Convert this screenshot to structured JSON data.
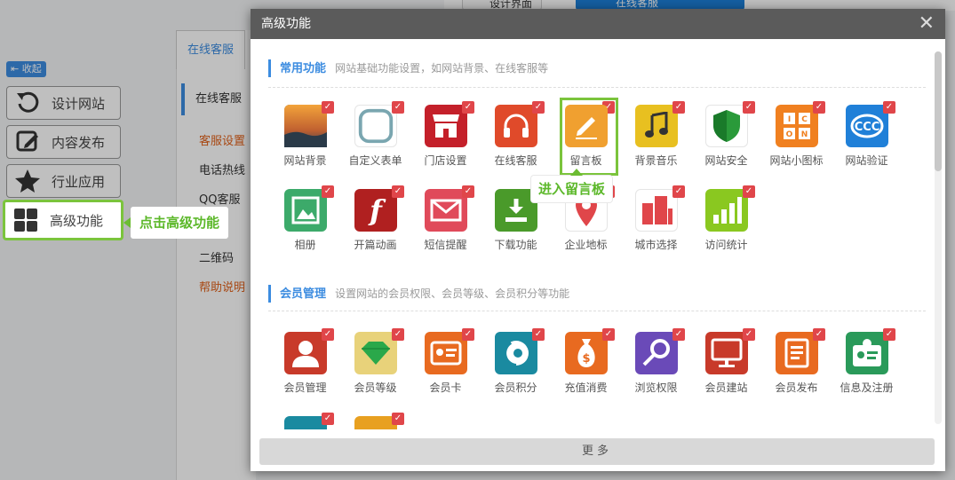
{
  "background": {
    "top_items": [
      "设计界面",
      "在线客服"
    ],
    "collapse_label": "收起",
    "nav": [
      {
        "label": "设计网站",
        "icon": "refresh-icon"
      },
      {
        "label": "内容发布",
        "icon": "edit-icon"
      },
      {
        "label": "行业应用",
        "icon": "star-icon"
      },
      {
        "label": "高级功能",
        "icon": "grid-icon"
      }
    ],
    "callout_left": "点击高级功能",
    "panel": {
      "tab": "在线客服",
      "head": "在线客服",
      "items": [
        "客服设置",
        "电话热线",
        "QQ客服",
        "二维码",
        "帮助说明"
      ]
    }
  },
  "modal": {
    "title": "高级功能",
    "close": "✕",
    "section1": {
      "name": "常用功能",
      "desc": "网站基础功能设置，如网站背景、在线客服等"
    },
    "section2": {
      "name": "会员管理",
      "desc": "设置网站的会员权限、会员等级、会员积分等功能"
    },
    "common": [
      {
        "label": "网站背景",
        "icon": "sunset-icon",
        "color": "#4a5a6a"
      },
      {
        "label": "自定义表单",
        "icon": "blank-form-icon",
        "color": "#ffffff"
      },
      {
        "label": "门店设置",
        "icon": "store-icon",
        "color": "#c4202a"
      },
      {
        "label": "在线客服",
        "icon": "headset-icon",
        "color": "#e04a2a"
      },
      {
        "label": "留言板",
        "icon": "pencil-icon",
        "color": "#f0a030"
      },
      {
        "label": "背景音乐",
        "icon": "music-note-icon",
        "color": "#e8c020"
      },
      {
        "label": "网站安全",
        "icon": "shield-icon",
        "color": "#ffffff"
      },
      {
        "label": "网站小图标",
        "icon": "icon-grid-icon",
        "color": "#f08020"
      },
      {
        "label": "网站验证",
        "icon": "verify-icon",
        "color": "#2080d8"
      },
      {
        "label": "相册",
        "icon": "album-icon",
        "color": "#3caa6a"
      },
      {
        "label": "开篇动画",
        "icon": "flash-icon",
        "color": "#b02020"
      },
      {
        "label": "短信提醒",
        "icon": "mail-icon",
        "color": "#e04a5a"
      },
      {
        "label": "下载功能",
        "icon": "download-icon",
        "color": "#4a9a2a"
      },
      {
        "label": "企业地标",
        "icon": "map-pin-icon",
        "color": "#ffffff"
      },
      {
        "label": "城市选择",
        "icon": "city-icon",
        "color": "#ffffff"
      },
      {
        "label": "访问统计",
        "icon": "bar-chart-icon",
        "color": "#8ac820"
      }
    ],
    "member": [
      {
        "label": "会员管理",
        "icon": "user-icon",
        "color": "#c83a2a"
      },
      {
        "label": "会员等级",
        "icon": "diamond-icon",
        "color": "#e8d27a"
      },
      {
        "label": "会员卡",
        "icon": "card-icon",
        "color": "#e86a20"
      },
      {
        "label": "会员积分",
        "icon": "points-icon",
        "color": "#1a8aa0"
      },
      {
        "label": "充值消费",
        "icon": "money-bag-icon",
        "color": "#e86a20"
      },
      {
        "label": "浏览权限",
        "icon": "key-icon",
        "color": "#6a4ab8"
      },
      {
        "label": "会员建站",
        "icon": "monitor-icon",
        "color": "#c83a2a"
      },
      {
        "label": "会员发布",
        "icon": "document-icon",
        "color": "#e86a20"
      },
      {
        "label": "信息及注册",
        "icon": "id-card-icon",
        "color": "#2a9a5a"
      }
    ],
    "member_extra_colors": [
      "#1a8aa0",
      "#e8a020"
    ],
    "callout_mid": "进入留言板",
    "more": "更多"
  }
}
